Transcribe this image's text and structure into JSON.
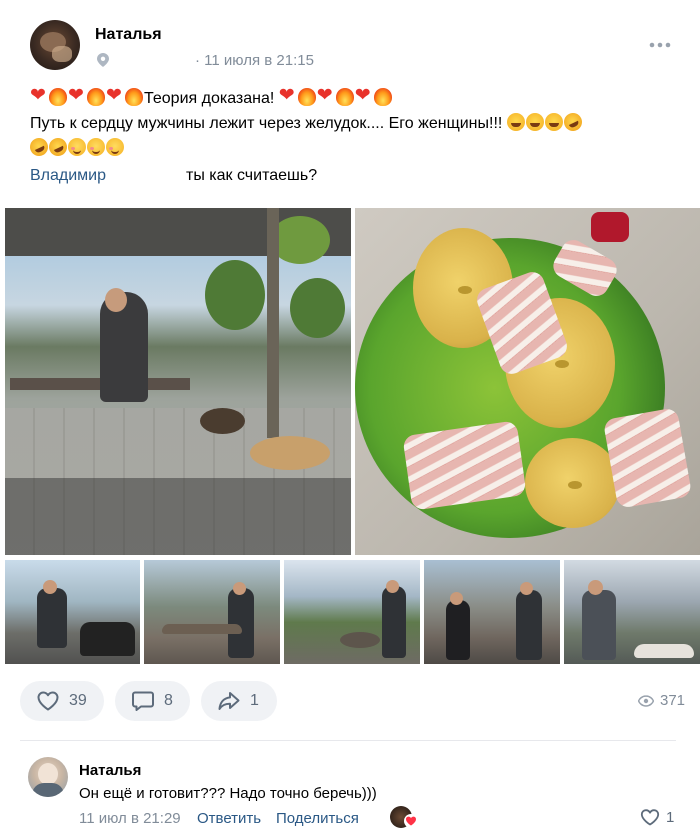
{
  "post": {
    "author": "Наталья",
    "date": "· 11 июля в 21:15",
    "text": {
      "line1": "Теория доказана!",
      "line2": "Путь к сердцу мужчины лежит через желудок.... Его женщины!!!",
      "mention": "Владимир",
      "line4": "ты как считаешь?"
    }
  },
  "actions": {
    "likes": "39",
    "comments": "8",
    "shares": "1",
    "views": "371"
  },
  "comment": {
    "author": "Наталья",
    "text": "Он ещё и готовит??? Надо точно беречь)))",
    "date": "11 июл в 21:29",
    "reply_label": "Ответить",
    "share_label": "Поделиться",
    "likes": "1"
  },
  "colors": {
    "link": "#2a5885",
    "secondary_text": "#818c99",
    "action_bg": "#f0f2f5"
  },
  "icons": [
    "map-pin-icon",
    "more-icon",
    "like-icon",
    "comment-icon",
    "share-icon",
    "views-icon",
    "heart-icon",
    "fire-emoji",
    "laugh-emoji",
    "rofl-emoji",
    "smile-emoji"
  ]
}
